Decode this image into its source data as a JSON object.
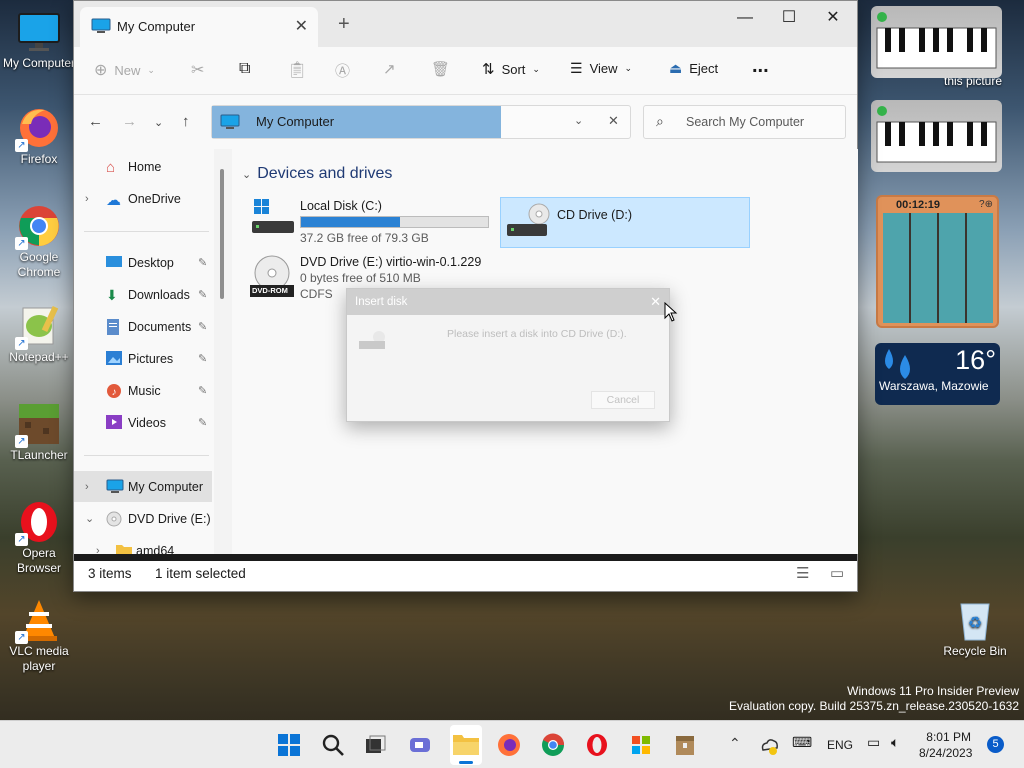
{
  "desktop": {
    "icons": [
      {
        "label": "My Computer",
        "icon": "monitor-icon"
      },
      {
        "label": "Firefox",
        "icon": "firefox-icon"
      },
      {
        "label": "Google Chrome",
        "icon": "chrome-icon"
      },
      {
        "label": "Notepad++",
        "icon": "notepad-icon"
      },
      {
        "label": "TLauncher",
        "icon": "minecraft-icon"
      },
      {
        "label": "Opera Browser",
        "icon": "opera-icon"
      },
      {
        "label": "VLC media player",
        "icon": "vlc-icon"
      }
    ],
    "recycle_bin": "Recycle Bin",
    "partial_text": "this picture",
    "watermark": {
      "line1": "Windows 11 Pro Insider Preview",
      "line2": "Evaluation copy. Build 25375.zn_release.230520-1632"
    }
  },
  "widgets": {
    "puzzle_timer": "00:12:19",
    "weather": {
      "temp": "16°",
      "location": "Warszawa, Mazowie"
    }
  },
  "explorer": {
    "tab_title": "My Computer",
    "toolbar": {
      "new": "New",
      "sort": "Sort",
      "view": "View",
      "eject": "Eject",
      "more": "..."
    },
    "address": "My Computer",
    "search_placeholder": "Search My Computer",
    "nav": {
      "home": "Home",
      "onedrive": "OneDrive",
      "desktop": "Desktop",
      "downloads": "Downloads",
      "documents": "Documents",
      "pictures": "Pictures",
      "music": "Music",
      "videos": "Videos",
      "mycomputer": "My Computer",
      "dvd": "DVD Drive (E:) vi",
      "amd64": "amd64"
    },
    "section": "Devices and drives",
    "drives": {
      "c": {
        "name": "Local Disk (C:)",
        "free": "37.2 GB free of 79.3 GB",
        "used_fraction": 0.53
      },
      "d": {
        "name": "CD Drive (D:)"
      },
      "e": {
        "name": "DVD Drive (E:) virtio-win-0.1.229",
        "free": "0 bytes free of 510 MB",
        "fs": "CDFS",
        "badge": "DVD-ROM"
      }
    },
    "status": {
      "count": "3 items",
      "selected": "1 item selected"
    }
  },
  "dialog": {
    "title": "Insert disk",
    "message": "Please insert a disk into CD Drive (D:).",
    "cancel": "Cancel"
  },
  "taskbar": {
    "lang": "ENG",
    "time": "8:01 PM",
    "date": "8/24/2023",
    "notif_count": "5"
  }
}
